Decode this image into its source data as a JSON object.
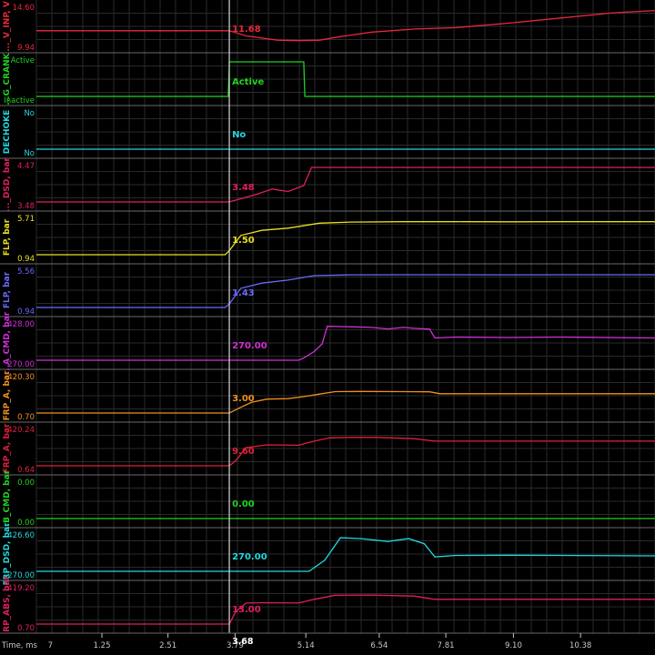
{
  "chart_data": {
    "type": "line",
    "time_axis": {
      "label": "Time, ms",
      "ticks": [
        "1.25",
        "2.51",
        "3.79",
        "5.14",
        "6.54",
        "7.81",
        "9.10",
        "10.38"
      ],
      "cursor_label": "3.68",
      "origin_label": "7"
    },
    "cursor_time": 3.68,
    "time_range": [
      0,
      11.8
    ],
    "colors": {
      "background": "#000000",
      "grid": "#2a2a2a",
      "separator": "#6a6a6a",
      "cursor": "#d8d8d8",
      "text": "#c8c8c8"
    },
    "channels": [
      {
        "name": "..._V_INP, V",
        "color": "#e8283c",
        "top_label": "14.60",
        "bottom_label": "9.94",
        "ylim": [
          9.94,
          14.6
        ],
        "cursor_value": "11.68",
        "points": [
          [
            0,
            11.68
          ],
          [
            3.68,
            11.68
          ],
          [
            4.0,
            11.0
          ],
          [
            4.6,
            10.4
          ],
          [
            5.0,
            10.35
          ],
          [
            5.4,
            10.4
          ],
          [
            5.8,
            10.9
          ],
          [
            6.4,
            11.5
          ],
          [
            7.2,
            11.9
          ],
          [
            8.0,
            12.1
          ],
          [
            9.0,
            12.7
          ],
          [
            10.0,
            13.4
          ],
          [
            11.0,
            14.1
          ],
          [
            11.8,
            14.4
          ]
        ]
      },
      {
        "name": "...G_CRANK",
        "color": "#1fd41f",
        "top_label": "Active",
        "bottom_label": "Inactive",
        "ylim": [
          0,
          1
        ],
        "cursor_value": "Active",
        "points": [
          [
            0,
            0
          ],
          [
            3.66,
            0
          ],
          [
            3.68,
            1
          ],
          [
            5.1,
            1
          ],
          [
            5.12,
            0
          ],
          [
            11.8,
            0
          ]
        ]
      },
      {
        "name": "DECHOKE",
        "color": "#22d8e0",
        "top_label": "No",
        "bottom_label": "No",
        "ylim": [
          0,
          1
        ],
        "cursor_value": "No",
        "points": [
          [
            0,
            0
          ],
          [
            11.8,
            0
          ]
        ]
      },
      {
        "name": "..._DSD, bar",
        "color": "#e0205a",
        "top_label": "4.47",
        "bottom_label": "3.48",
        "ylim": [
          3.48,
          4.47
        ],
        "cursor_value": "3.48",
        "points": [
          [
            0,
            3.48
          ],
          [
            3.68,
            3.48
          ],
          [
            4.2,
            3.7
          ],
          [
            4.5,
            3.85
          ],
          [
            4.8,
            3.78
          ],
          [
            5.1,
            3.95
          ],
          [
            5.25,
            4.47
          ],
          [
            11.8,
            4.47
          ]
        ]
      },
      {
        "name": "FLP, bar",
        "color": "#e8e020",
        "top_label": "5.71",
        "bottom_label": "0.94",
        "ylim": [
          0.94,
          5.71
        ],
        "cursor_value": "1.50",
        "points": [
          [
            0,
            0.94
          ],
          [
            3.6,
            0.94
          ],
          [
            3.68,
            1.5
          ],
          [
            3.9,
            3.6
          ],
          [
            4.3,
            4.3
          ],
          [
            4.8,
            4.6
          ],
          [
            5.4,
            5.3
          ],
          [
            6.0,
            5.45
          ],
          [
            7.0,
            5.5
          ],
          [
            8.0,
            5.5
          ],
          [
            9.0,
            5.48
          ],
          [
            10.0,
            5.5
          ],
          [
            11.8,
            5.5
          ]
        ]
      },
      {
        "name": "FLP, bar",
        "color": "#6a6aff",
        "top_label": "5.56",
        "bottom_label": "0.94",
        "ylim": [
          0.94,
          5.56
        ],
        "cursor_value": "1.43",
        "points": [
          [
            0,
            0.94
          ],
          [
            3.6,
            0.94
          ],
          [
            3.68,
            1.43
          ],
          [
            3.9,
            3.5
          ],
          [
            4.3,
            4.2
          ],
          [
            4.8,
            4.6
          ],
          [
            5.3,
            5.2
          ],
          [
            6.0,
            5.3
          ],
          [
            7.0,
            5.32
          ],
          [
            8.0,
            5.32
          ],
          [
            9.0,
            5.3
          ],
          [
            10.0,
            5.32
          ],
          [
            11.8,
            5.32
          ]
        ]
      },
      {
        "name": "...A_CMD, bar",
        "color": "#d030d8",
        "top_label": "428.00",
        "bottom_label": "270.00",
        "ylim": [
          270,
          428
        ],
        "cursor_value": "270.00",
        "points": [
          [
            0,
            270
          ],
          [
            5.0,
            270
          ],
          [
            5.1,
            280
          ],
          [
            5.3,
            310
          ],
          [
            5.45,
            345
          ],
          [
            5.55,
            425
          ],
          [
            6.0,
            423
          ],
          [
            6.4,
            420
          ],
          [
            6.7,
            413
          ],
          [
            7.0,
            420
          ],
          [
            7.2,
            416
          ],
          [
            7.5,
            412
          ],
          [
            7.6,
            372
          ],
          [
            8.0,
            376
          ],
          [
            9.0,
            374
          ],
          [
            10.0,
            376
          ],
          [
            11.8,
            372
          ]
        ]
      },
      {
        "name": "FRP_A, bar",
        "color": "#f09020",
        "top_label": "420.30",
        "bottom_label": "0.70",
        "ylim": [
          0.7,
          420.3
        ],
        "cursor_value": "3.00",
        "points": [
          [
            0,
            0.7
          ],
          [
            3.68,
            0.7
          ],
          [
            3.9,
            70
          ],
          [
            4.1,
            130
          ],
          [
            4.4,
            170
          ],
          [
            4.8,
            175
          ],
          [
            5.1,
            200
          ],
          [
            5.4,
            230
          ],
          [
            5.7,
            260
          ],
          [
            6.2,
            262
          ],
          [
            7.0,
            260
          ],
          [
            7.5,
            258
          ],
          [
            7.7,
            235
          ],
          [
            9.0,
            235
          ],
          [
            11.8,
            235
          ]
        ]
      },
      {
        "name": "FRP_A, bar",
        "color": "#e0203a",
        "top_label": "420.24",
        "bottom_label": "0.64",
        "ylim": [
          0.64,
          420.24
        ],
        "cursor_value": "9.60",
        "points": [
          [
            0,
            0.64
          ],
          [
            3.68,
            0.64
          ],
          [
            3.8,
            60
          ],
          [
            4.0,
            220
          ],
          [
            4.4,
            255
          ],
          [
            5.0,
            250
          ],
          [
            5.3,
            300
          ],
          [
            5.6,
            340
          ],
          [
            6.0,
            345
          ],
          [
            6.5,
            345
          ],
          [
            7.2,
            330
          ],
          [
            7.6,
            300
          ],
          [
            8.5,
            300
          ],
          [
            11.8,
            300
          ]
        ]
      },
      {
        "name": "...B_CMD, bar",
        "color": "#1fd41f",
        "top_label": "0.00",
        "bottom_label": "0.00",
        "ylim": [
          0,
          1
        ],
        "cursor_value": "0.00",
        "points": [
          [
            0,
            0
          ],
          [
            11.8,
            0
          ]
        ]
      },
      {
        "name": "FRP_DSD, bar",
        "color": "#22d8e0",
        "top_label": "426.60",
        "bottom_label": "270.00",
        "ylim": [
          270,
          426.6
        ],
        "cursor_value": "270.00",
        "points": [
          [
            0,
            270
          ],
          [
            5.2,
            270
          ],
          [
            5.5,
            320
          ],
          [
            5.8,
            422
          ],
          [
            6.2,
            418
          ],
          [
            6.7,
            405
          ],
          [
            7.1,
            418
          ],
          [
            7.4,
            395
          ],
          [
            7.6,
            335
          ],
          [
            8.0,
            342
          ],
          [
            9.0,
            343
          ],
          [
            10.0,
            342
          ],
          [
            11.8,
            340
          ]
        ]
      },
      {
        "name": "FRP_ABS, bar",
        "color": "#e0205a",
        "top_label": "419.20",
        "bottom_label": "0.70",
        "ylim": [
          0.7,
          419.2
        ],
        "cursor_value": "13.00",
        "points": [
          [
            0,
            0.7
          ],
          [
            3.68,
            0.7
          ],
          [
            3.8,
            150
          ],
          [
            4.0,
            255
          ],
          [
            4.4,
            260
          ],
          [
            5.0,
            255
          ],
          [
            5.3,
            300
          ],
          [
            5.7,
            350
          ],
          [
            6.4,
            352
          ],
          [
            7.2,
            340
          ],
          [
            7.6,
            300
          ],
          [
            9.0,
            300
          ],
          [
            11.8,
            300
          ]
        ]
      }
    ]
  }
}
